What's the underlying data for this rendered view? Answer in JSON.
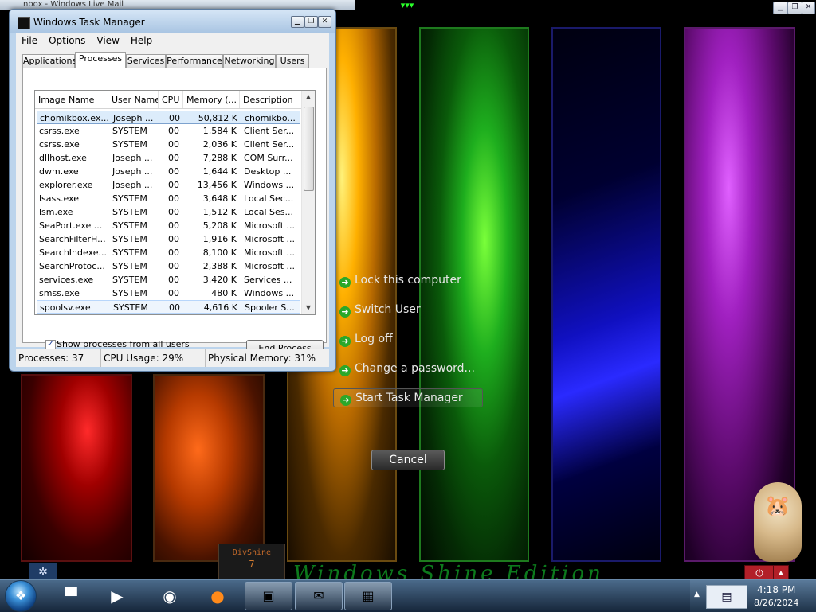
{
  "background_window_title": "Inbox - Windows Live Mail",
  "security_menu": {
    "items": [
      {
        "label": "Lock this computer"
      },
      {
        "label": "Switch User"
      },
      {
        "label": "Log off"
      },
      {
        "label": "Change a password..."
      },
      {
        "label": "Start Task Manager"
      }
    ],
    "cancel_label": "Cancel"
  },
  "wallpaper_text": "Windows Shine Edition",
  "gadget": {
    "name": "DivShine",
    "value": "7"
  },
  "task_manager": {
    "title": "Windows Task Manager",
    "menu": [
      "File",
      "Options",
      "View",
      "Help"
    ],
    "tabs": [
      "Applications",
      "Processes",
      "Services",
      "Performance",
      "Networking",
      "Users"
    ],
    "selected_tab": "Processes",
    "columns": [
      "Image Name",
      "User Name",
      "CPU",
      "Memory (...",
      "Description"
    ],
    "rows": [
      {
        "image": "chomikbox.ex...",
        "user": "Joseph ...",
        "cpu": "00",
        "mem": "50,812 K",
        "desc": "chomikbo..."
      },
      {
        "image": "csrss.exe",
        "user": "SYSTEM",
        "cpu": "00",
        "mem": "1,584 K",
        "desc": "Client Ser..."
      },
      {
        "image": "csrss.exe",
        "user": "SYSTEM",
        "cpu": "00",
        "mem": "2,036 K",
        "desc": "Client Ser..."
      },
      {
        "image": "dllhost.exe",
        "user": "Joseph ...",
        "cpu": "00",
        "mem": "7,288 K",
        "desc": "COM Surr..."
      },
      {
        "image": "dwm.exe",
        "user": "Joseph ...",
        "cpu": "00",
        "mem": "1,644 K",
        "desc": "Desktop ..."
      },
      {
        "image": "explorer.exe",
        "user": "Joseph ...",
        "cpu": "00",
        "mem": "13,456 K",
        "desc": "Windows ..."
      },
      {
        "image": "lsass.exe",
        "user": "SYSTEM",
        "cpu": "00",
        "mem": "3,648 K",
        "desc": "Local Sec..."
      },
      {
        "image": "lsm.exe",
        "user": "SYSTEM",
        "cpu": "00",
        "mem": "1,512 K",
        "desc": "Local Ses..."
      },
      {
        "image": "SeaPort.exe ...",
        "user": "SYSTEM",
        "cpu": "00",
        "mem": "5,208 K",
        "desc": "Microsoft ..."
      },
      {
        "image": "SearchFilterH...",
        "user": "SYSTEM",
        "cpu": "00",
        "mem": "1,916 K",
        "desc": "Microsoft ..."
      },
      {
        "image": "SearchIndexe...",
        "user": "SYSTEM",
        "cpu": "00",
        "mem": "8,100 K",
        "desc": "Microsoft ..."
      },
      {
        "image": "SearchProtoc...",
        "user": "SYSTEM",
        "cpu": "00",
        "mem": "2,388 K",
        "desc": "Microsoft ..."
      },
      {
        "image": "services.exe",
        "user": "SYSTEM",
        "cpu": "00",
        "mem": "3,420 K",
        "desc": "Services ..."
      },
      {
        "image": "smss.exe",
        "user": "SYSTEM",
        "cpu": "00",
        "mem": "480 K",
        "desc": "Windows ..."
      },
      {
        "image": "spoolsv.exe",
        "user": "SYSTEM",
        "cpu": "00",
        "mem": "4,616 K",
        "desc": "Spooler S..."
      }
    ],
    "show_all_label": "Show processes from all users",
    "show_all_checked": "✓",
    "end_process_label": "End Process",
    "status": {
      "processes": "Processes: 37",
      "cpu": "CPU Usage: 29%",
      "memory": "Physical Memory: 31%"
    }
  },
  "taskbar": {
    "time": "4:18 PM",
    "date": "8/26/2024"
  }
}
